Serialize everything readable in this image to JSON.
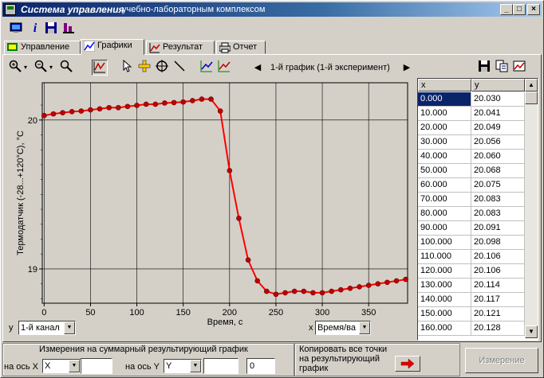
{
  "window": {
    "title": "Система управления",
    "subtitle": "учебно-лабораторным комплексом",
    "controls": [
      "minimize",
      "maximize",
      "close"
    ]
  },
  "toolbar_main": {
    "icons": [
      "monitor-icon",
      "info-icon",
      "save-disk-icon",
      "equipment-icon"
    ]
  },
  "tabs": [
    {
      "label": "Управление",
      "icon": "control-icon",
      "active": false
    },
    {
      "label": "Графики",
      "icon": "chart-icon",
      "active": true
    },
    {
      "label": "Результат",
      "icon": "result-icon",
      "active": false
    },
    {
      "label": "Отчет",
      "icon": "printer-icon",
      "active": false
    }
  ],
  "chart_toolbar": {
    "icons": [
      "zoom-in-icon",
      "zoom-out-icon",
      "zoom-fit-icon",
      "graph-view-icon",
      "pointer-icon",
      "move-cross-icon",
      "target-icon",
      "line-tool-icon",
      "add-points-icon",
      "remove-points-icon"
    ],
    "chart_selector": "1-й график (1-й эксперимент)",
    "right_icons": [
      "save-disk-icon",
      "copy-icon",
      "export-chart-icon"
    ]
  },
  "chart_data": {
    "type": "line",
    "ylabel": "Термодатчик (-28...+120°C), °C",
    "xlabel": "Время, с",
    "xlim": [
      -2,
      392
    ],
    "ylim": [
      18.77,
      20.25
    ],
    "xticks": [
      0,
      50,
      100,
      150,
      200,
      250,
      300,
      350
    ],
    "yticks": [
      19,
      20
    ],
    "grid": true,
    "line_color": "#ff0000",
    "marker_color": "#c00000",
    "x": [
      0,
      10,
      20,
      30,
      40,
      50,
      60,
      70,
      80,
      90,
      100,
      110,
      120,
      130,
      140,
      150,
      160,
      170,
      180,
      190,
      200,
      210,
      220,
      230,
      240,
      250,
      260,
      270,
      280,
      290,
      300,
      310,
      320,
      330,
      340,
      350,
      360,
      370,
      380,
      390
    ],
    "y": [
      20.03,
      20.041,
      20.049,
      20.056,
      20.06,
      20.068,
      20.075,
      20.083,
      20.083,
      20.091,
      20.098,
      20.106,
      20.106,
      20.114,
      20.117,
      20.121,
      20.13,
      20.14,
      20.14,
      20.06,
      19.66,
      19.34,
      19.06,
      18.92,
      18.85,
      18.83,
      18.84,
      18.85,
      18.85,
      18.84,
      18.84,
      18.85,
      18.86,
      18.87,
      18.88,
      18.89,
      18.9,
      18.91,
      18.92,
      18.93
    ]
  },
  "axis_selectors": {
    "y_label": "y",
    "y_value": "1-й канал",
    "x_label": "x",
    "x_value": "Время/ва"
  },
  "table": {
    "columns": [
      "x",
      "y"
    ],
    "rows": [
      [
        "0.000",
        "20.030"
      ],
      [
        "10.000",
        "20.041"
      ],
      [
        "20.000",
        "20.049"
      ],
      [
        "30.000",
        "20.056"
      ],
      [
        "40.000",
        "20.060"
      ],
      [
        "50.000",
        "20.068"
      ],
      [
        "60.000",
        "20.075"
      ],
      [
        "70.000",
        "20.083"
      ],
      [
        "80.000",
        "20.083"
      ],
      [
        "90.000",
        "20.091"
      ],
      [
        "100.000",
        "20.098"
      ],
      [
        "110.000",
        "20.106"
      ],
      [
        "120.000",
        "20.106"
      ],
      [
        "130.000",
        "20.114"
      ],
      [
        "140.000",
        "20.117"
      ],
      [
        "150.000",
        "20.121"
      ],
      [
        "160.000",
        "20.128"
      ]
    ]
  },
  "bottom": {
    "group_title": "Измерения на суммарный результирующий график",
    "x_axis_label": "на ось X",
    "x_axis_value": "X",
    "x_input_value": "",
    "y_axis_label": "на ось Y",
    "y_axis_value": "Y",
    "y_input_value": "",
    "counter_value": "0",
    "copy_label_1": "Копировать все точки",
    "copy_label_2": "на результирующий",
    "copy_label_3": "график",
    "measure_button": "Измерение"
  }
}
